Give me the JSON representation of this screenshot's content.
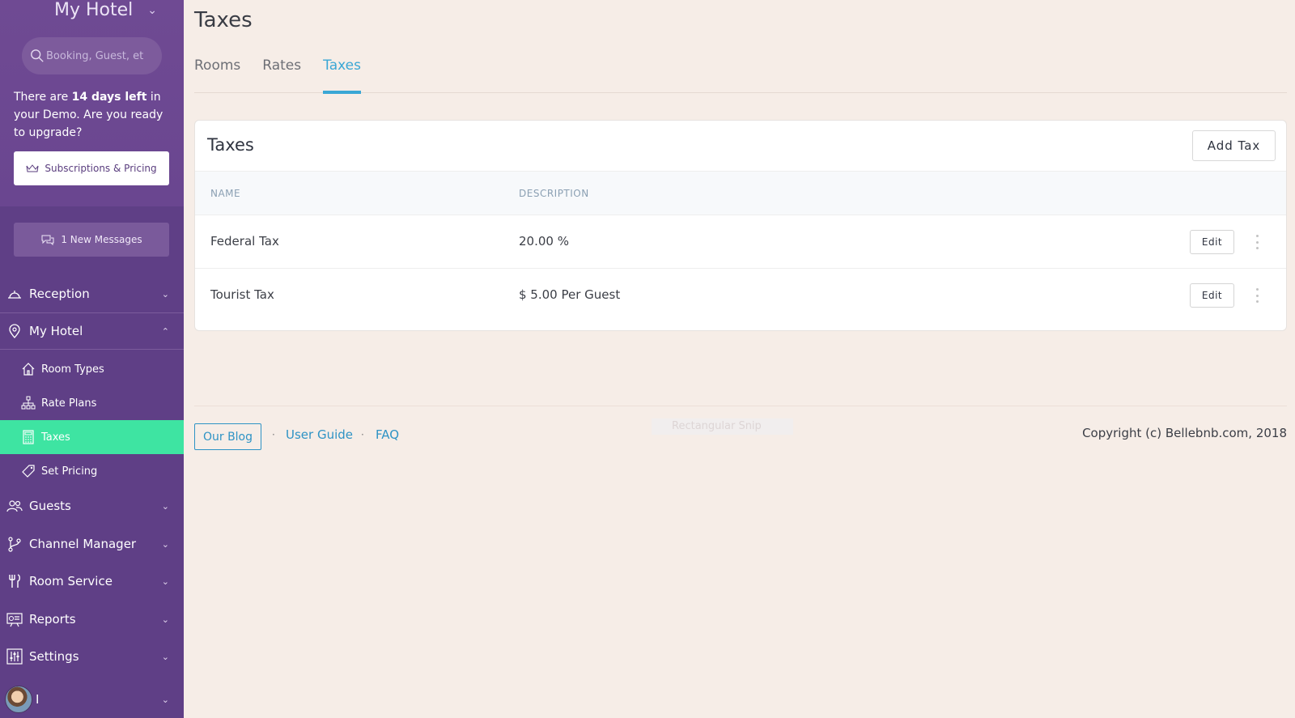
{
  "sidebar": {
    "hotel_name": "My Hotel",
    "search_placeholder": "Booking, Guest, et",
    "demo": {
      "prefix": "There are ",
      "days": "14 days left",
      "suffix": " in your Demo. Are you ready to upgrade?"
    },
    "subscriptions_label": "Subscriptions & Pricing",
    "messages_label": "1 New Messages",
    "nav": {
      "reception": "Reception",
      "my_hotel": "My Hotel",
      "room_types": "Room Types",
      "rate_plans": "Rate Plans",
      "taxes": "Taxes",
      "set_pricing": "Set Pricing",
      "guests": "Guests",
      "channel_manager": "Channel Manager",
      "room_service": "Room Service",
      "reports": "Reports",
      "settings": "Settings"
    },
    "user_name": "I"
  },
  "page": {
    "title": "Taxes",
    "tabs": [
      "Rooms",
      "Rates",
      "Taxes"
    ],
    "active_tab": "Taxes"
  },
  "card": {
    "title": "Taxes",
    "add_label": "Add Tax",
    "columns": [
      "NAME",
      "DESCRIPTION"
    ],
    "rows": [
      {
        "name": "Federal Tax",
        "description": "20.00 %",
        "edit": "Edit"
      },
      {
        "name": "Tourist Tax",
        "description": "$ 5.00 Per Guest",
        "edit": "Edit"
      }
    ]
  },
  "footer": {
    "blog": "Our Blog",
    "separator": "·",
    "user_guide": "User Guide",
    "faq": "FAQ",
    "snip_overlay": "Rectangular Snip",
    "copyright": "Copyright (c) Bellebnb.com, 2018"
  },
  "colors": {
    "sidebar_bg": "#5f3f86",
    "active_item": "#3ee4a2",
    "accent": "#3aa7d5",
    "page_bg": "#f6ede7"
  }
}
